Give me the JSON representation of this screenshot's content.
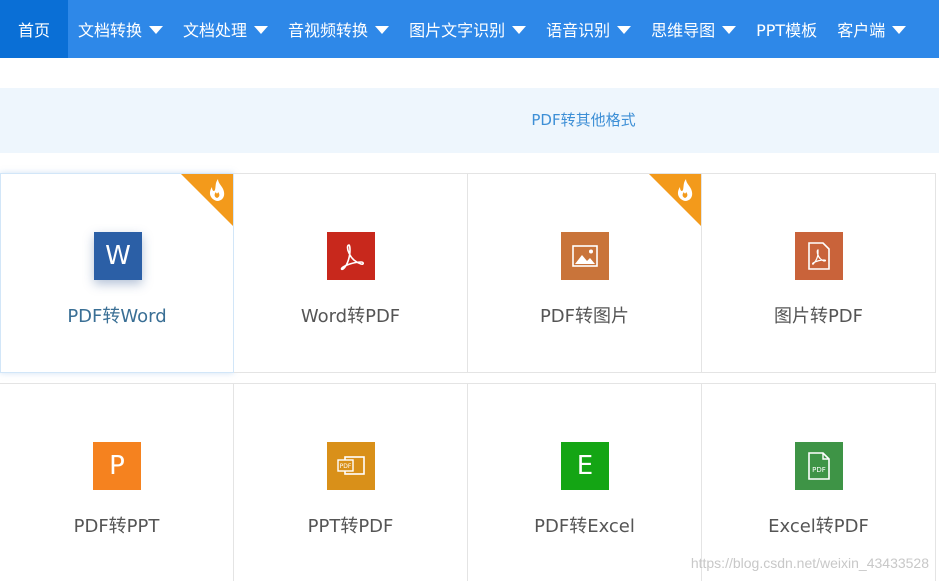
{
  "nav": {
    "items": [
      {
        "label": "首页",
        "dropdown": false,
        "active": true
      },
      {
        "label": "文档转换",
        "dropdown": true
      },
      {
        "label": "文档处理",
        "dropdown": true
      },
      {
        "label": "音视频转换",
        "dropdown": true
      },
      {
        "label": "图片文字识别",
        "dropdown": true
      },
      {
        "label": "语音识别",
        "dropdown": true
      },
      {
        "label": "思维导图",
        "dropdown": true
      },
      {
        "label": "PPT模板",
        "dropdown": false
      },
      {
        "label": "客户端",
        "dropdown": true
      }
    ],
    "colors": {
      "bar": "#2e88e8",
      "active": "#0a6fd6"
    }
  },
  "subbar": {
    "label": "PDF转其他格式"
  },
  "cards": [
    {
      "label": "PDF转Word",
      "icon": "word-icon",
      "glyph": "W",
      "color": "#2b5fa6",
      "hot": true
    },
    {
      "label": "Word转PDF",
      "icon": "acrobat-icon",
      "color": "#c8281c",
      "hot": false
    },
    {
      "label": "PDF转图片",
      "icon": "image-icon",
      "color": "#c9743a",
      "hot": true
    },
    {
      "label": "图片转PDF",
      "icon": "pdf-doc-icon",
      "color": "#c9633a",
      "hot": false
    },
    {
      "label": "PDF转PPT",
      "icon": "ppt-icon",
      "glyph": "P",
      "color": "#f5821f",
      "hot": false
    },
    {
      "label": "PPT转PDF",
      "icon": "ppt-pdf-icon",
      "color": "#d99019",
      "hot": false
    },
    {
      "label": "PDF转Excel",
      "icon": "excel-icon",
      "glyph": "E",
      "color": "#14a514",
      "hot": false
    },
    {
      "label": "Excel转PDF",
      "icon": "pdf-file-icon",
      "color": "#3e9446",
      "hot": false
    }
  ],
  "watermark": "https://blog.csdn.net/weixin_43433528"
}
